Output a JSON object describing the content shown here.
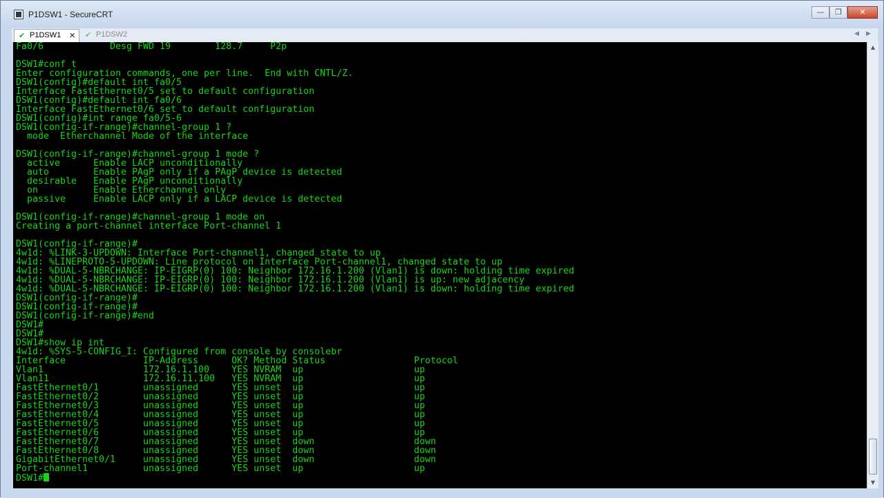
{
  "window": {
    "title": "P1DSW1 - SecureCRT",
    "controls": {
      "minimize": "—",
      "restore": "❐",
      "close": "✕"
    }
  },
  "tabs": [
    {
      "label": "P1DSW1",
      "active": true,
      "close_glyph": "✕",
      "status_icon": "check-icon"
    },
    {
      "label": "P1DSW2",
      "active": false,
      "status_icon": "check-icon"
    }
  ],
  "tab_nav": {
    "prev": "◀",
    "next": "▶"
  },
  "terminal": {
    "text_color": "#18d418",
    "background": "#000000",
    "lines": [
      "Fa0/6            Desg FWD 19        128.7     P2p",
      "",
      "DSW1#conf t",
      "Enter configuration commands, one per line.  End with CNTL/Z.",
      "DSW1(config)#default int fa0/5",
      "Interface FastEthernet0/5 set to default configuration",
      "DSW1(config)#default int fa0/6",
      "Interface FastEthernet0/6 set to default configuration",
      "DSW1(config)#int range fa0/5-6",
      "DSW1(config-if-range)#channel-group 1 ?",
      "  mode  Etherchannel Mode of the interface",
      "",
      "DSW1(config-if-range)#channel-group 1 mode ?",
      "  active      Enable LACP unconditionally",
      "  auto        Enable PAgP only if a PAgP device is detected",
      "  desirable   Enable PAgP unconditionally",
      "  on          Enable Etherchannel only",
      "  passive     Enable LACP only if a LACP device is detected",
      "",
      "DSW1(config-if-range)#channel-group 1 mode on",
      "Creating a port-channel interface Port-channel 1",
      "",
      "DSW1(config-if-range)#",
      "4w1d: %LINK-3-UPDOWN: Interface Port-channel1, changed state to up",
      "4w1d: %LINEPROTO-5-UPDOWN: Line protocol on Interface Port-channel1, changed state to up",
      "4w1d: %DUAL-5-NBRCHANGE: IP-EIGRP(0) 100: Neighbor 172.16.1.200 (Vlan1) is down: holding time expired",
      "4w1d: %DUAL-5-NBRCHANGE: IP-EIGRP(0) 100: Neighbor 172.16.1.200 (Vlan1) is up: new adjacency",
      "4w1d: %DUAL-5-NBRCHANGE: IP-EIGRP(0) 100: Neighbor 172.16.1.200 (Vlan1) is down: holding time expired",
      "DSW1(config-if-range)#",
      "DSW1(config-if-range)#",
      "DSW1(config-if-range)#end",
      "DSW1#",
      "DSW1#",
      "DSW1#show ip int",
      "4w1d: %SYS-5-CONFIG_I: Configured from console by consolebr",
      "Interface              IP-Address      OK? Method Status                Protocol",
      "Vlan1                  172.16.1.100    YES NVRAM  up                    up",
      "Vlan11                 172.16.11.100   YES NVRAM  up                    up",
      "FastEthernet0/1        unassigned      YES unset  up                    up",
      "FastEthernet0/2        unassigned      YES unset  up                    up",
      "FastEthernet0/3        unassigned      YES unset  up                    up",
      "FastEthernet0/4        unassigned      YES unset  up                    up",
      "FastEthernet0/5        unassigned      YES unset  up                    up",
      "FastEthernet0/6        unassigned      YES unset  up                    up",
      "FastEthernet0/7        unassigned      YES unset  down                  down",
      "FastEthernet0/8        unassigned      YES unset  down                  down",
      "GigabitEthernet0/1     unassigned      YES unset  down                  down",
      "Port-channel1          unassigned      YES unset  up                    up"
    ],
    "prompt": "DSW1#"
  },
  "scrollbar": {
    "up_arrow": "▲",
    "down_arrow": "▼"
  }
}
